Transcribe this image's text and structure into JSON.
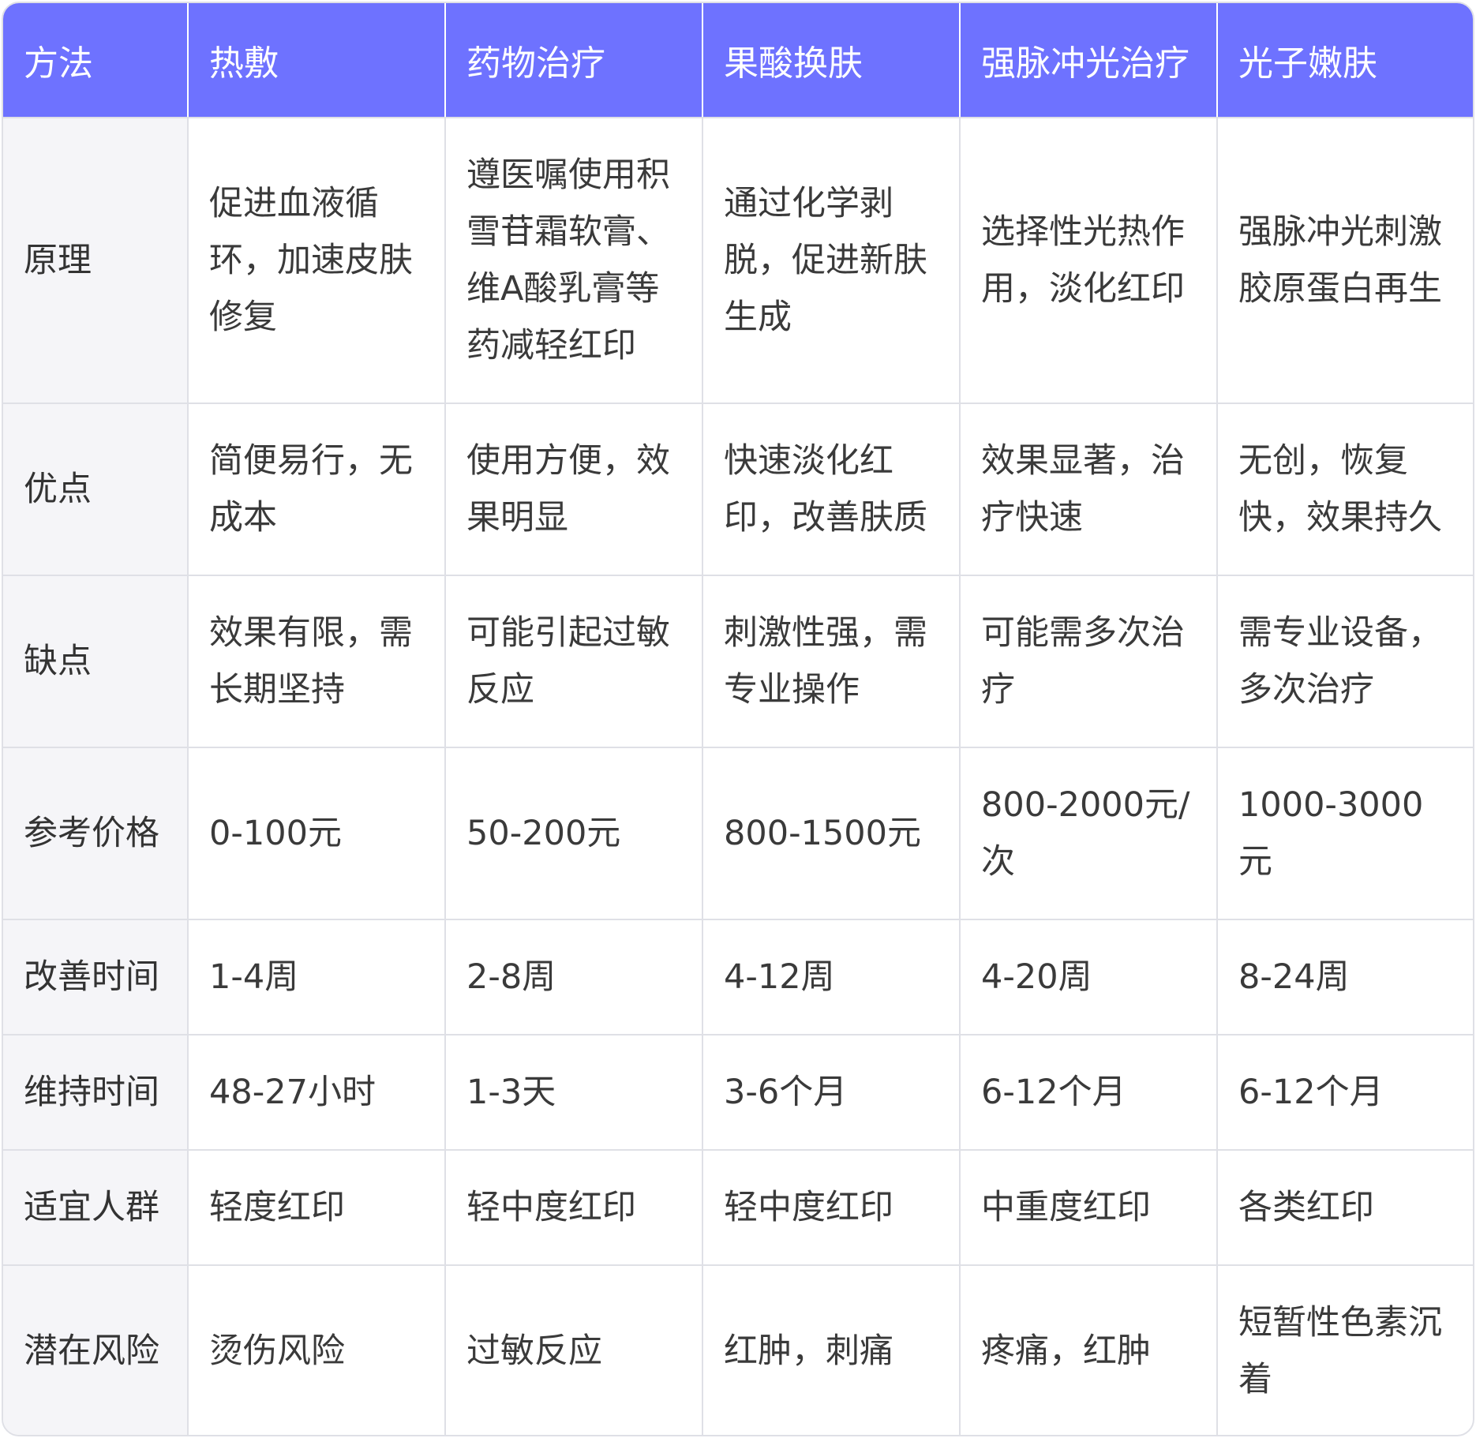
{
  "table": {
    "headers": [
      "方法",
      "热敷",
      "药物治疗",
      "果酸换肤",
      "强脉冲光治疗",
      "光子嫩肤"
    ],
    "rows": [
      {
        "label": "原理",
        "cells": [
          "促进血液循环，加速皮肤修复",
          "遵医嘱使用积雪苷霜软膏、维A酸乳膏等药减轻红印",
          "通过化学剥脱，促进新肤生成",
          "选择性光热作用，淡化红印",
          "强脉冲光刺激胶原蛋白再生"
        ]
      },
      {
        "label": "优点",
        "cells": [
          "简便易行，无成本",
          "使用方便，效果明显",
          "快速淡化红印，改善肤质",
          "效果显著，治疗快速",
          "无创，恢复快，效果持久"
        ]
      },
      {
        "label": "缺点",
        "cells": [
          "效果有限，需长期坚持",
          "可能引起过敏反应",
          "刺激性强，需专业操作",
          "可能需多次治疗",
          "需专业设备，多次治疗"
        ]
      },
      {
        "label": "参考价格",
        "cells": [
          "0-100元",
          "50-200元",
          "800-1500元",
          "800-2000元/次",
          "1000-3000元"
        ]
      },
      {
        "label": "改善时间",
        "cells": [
          "1-4周",
          "2-8周",
          "4-12周",
          "4-20周",
          "8-24周"
        ]
      },
      {
        "label": "维持时间",
        "cells": [
          "48-27小时",
          "1-3天",
          "3-6个月",
          "6-12个月",
          "6-12个月"
        ]
      },
      {
        "label": "适宜人群",
        "cells": [
          "轻度红印",
          "轻中度红印",
          "轻中度红印",
          "中重度红印",
          "各类红印"
        ]
      },
      {
        "label": "潜在风险",
        "cells": [
          "烫伤风险",
          "过敏反应",
          "红肿，刺痛",
          "疼痛，红肿",
          "短暂性色素沉着"
        ]
      }
    ]
  },
  "colors": {
    "header_bg": "#6e72ff",
    "header_text": "#ffffff",
    "rowhead_bg": "#f5f5f8",
    "border": "#dfe0e6",
    "text": "#3a3a3a"
  }
}
